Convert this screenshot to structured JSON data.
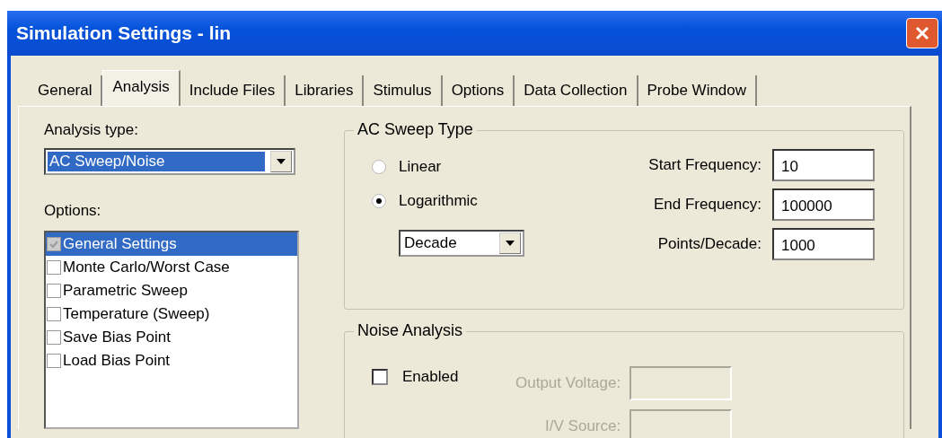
{
  "window": {
    "title": "Simulation Settings - lin"
  },
  "tabs": [
    {
      "label": "General",
      "selected": false
    },
    {
      "label": "Analysis",
      "selected": true
    },
    {
      "label": "Include Files",
      "selected": false
    },
    {
      "label": "Libraries",
      "selected": false
    },
    {
      "label": "Stimulus",
      "selected": false
    },
    {
      "label": "Options",
      "selected": false
    },
    {
      "label": "Data Collection",
      "selected": false
    },
    {
      "label": "Probe Window",
      "selected": false
    }
  ],
  "analysis_type": {
    "label": "Analysis type:",
    "value": "AC Sweep/Noise"
  },
  "options": {
    "label": "Options:",
    "items": [
      {
        "label": "General Settings",
        "checked": true,
        "selected": true,
        "disabled": true
      },
      {
        "label": "Monte Carlo/Worst Case",
        "checked": false,
        "selected": false,
        "disabled": false
      },
      {
        "label": "Parametric Sweep",
        "checked": false,
        "selected": false,
        "disabled": false
      },
      {
        "label": "Temperature (Sweep)",
        "checked": false,
        "selected": false,
        "disabled": false
      },
      {
        "label": "Save Bias Point",
        "checked": false,
        "selected": false,
        "disabled": false
      },
      {
        "label": "Load Bias Point",
        "checked": false,
        "selected": false,
        "disabled": false
      }
    ]
  },
  "ac_sweep": {
    "title": "AC Sweep Type",
    "radios": [
      {
        "label": "Linear",
        "selected": false
      },
      {
        "label": "Logarithmic",
        "selected": true
      }
    ],
    "scale": "Decade",
    "fields": [
      {
        "label": "Start Frequency:",
        "value": "10"
      },
      {
        "label": "End Frequency:",
        "value": "100000"
      },
      {
        "label": "Points/Decade:",
        "value": "1000"
      }
    ]
  },
  "noise": {
    "title": "Noise Analysis",
    "enabled": {
      "label": "Enabled",
      "checked": false
    },
    "fields": [
      {
        "label": "Output Voltage:",
        "disabled": true
      },
      {
        "label": "I/V Source:",
        "disabled": true
      }
    ]
  }
}
